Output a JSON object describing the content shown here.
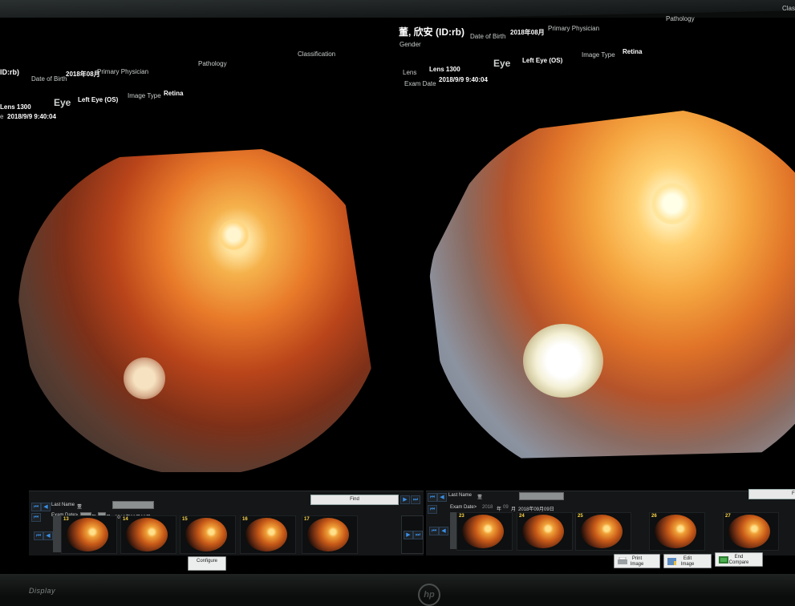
{
  "left_panel": {
    "id_fragment": "ID:rb)",
    "dob_label": "Date of Birth",
    "dob_value": "2018年08月",
    "physician_label": "Primary Physician",
    "pathology_label": "Pathology",
    "classification_label": "Classification",
    "lens_fragment": "Lens 1300",
    "eye_label": "Eye",
    "eye_value": "Left Eye (OS)",
    "image_type_label": "Image Type",
    "image_type_value": "Retina",
    "exam_fragment": "e",
    "exam_value": "2018/9/9 9:40:04"
  },
  "right_panel": {
    "patient_name": "董, 欣安 (ID:rb)",
    "gender_label": "Gender",
    "dob_label": "Date of Birth",
    "dob_value": "2018年08月",
    "physician_label": "Primary Physician",
    "pathology_label": "Pathology",
    "lens_label": "Lens",
    "lens_value": "Lens 1300",
    "exam_label": "Exam Date",
    "exam_value": "2018/9/9 9:40:04",
    "eye_label": "Eye",
    "eye_value": "Left Eye (OS)",
    "image_type_label": "Image Type",
    "image_type_value": "Retina",
    "edge_fragment": "Classi"
  },
  "left_strip": {
    "last_name_label": "Last Name",
    "last_name_value": "董",
    "find_label": "Find",
    "exam_date_label": "Exam Date>",
    "date_year_suffix": "年",
    "date_month_suffix": "月",
    "date_value": "2018年09月09日",
    "thumbnails": [
      "13",
      "14",
      "15",
      "16",
      "17"
    ],
    "configure_label": "Configure"
  },
  "right_strip": {
    "last_name_label": "Last Name",
    "last_name_value": "董",
    "find_fragment": "Fi",
    "exam_date_label": "Exam Date>",
    "date_prefix": "2018",
    "date_year_suffix": "年",
    "date_month_field": "09",
    "date_month_suffix": "月",
    "date_value": "2018年09月09日",
    "thumbnails": [
      "23",
      "24",
      "25",
      "26",
      "27"
    ],
    "print_label_1": "Print",
    "print_label_2": "Image",
    "edit_label_1": "Edit",
    "edit_label_2": "Image",
    "end_label_1": "End",
    "end_label_2": "Compare"
  },
  "monitor": {
    "left_brand": "Display",
    "logo": "hp"
  },
  "colors": {
    "nav_blue": "#3a8fe6",
    "thumb_number": "#ffd84a",
    "background": "#000000"
  }
}
